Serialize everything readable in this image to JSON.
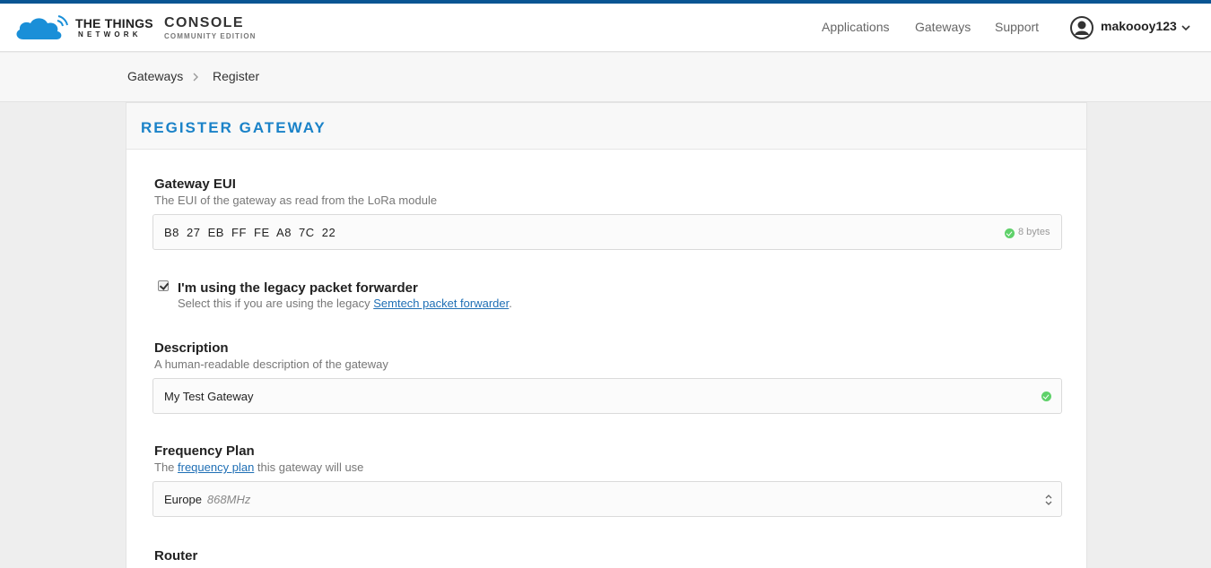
{
  "brand": {
    "name_line1": "THE THINGS",
    "name_line2": "NETWORK",
    "product": "CONSOLE",
    "edition": "COMMUNITY EDITION"
  },
  "nav": {
    "applications": "Applications",
    "gateways": "Gateways",
    "support": "Support",
    "username": "makoooy123"
  },
  "breadcrumb": {
    "items": [
      "Gateways",
      "Register"
    ]
  },
  "page": {
    "title": "REGISTER GATEWAY"
  },
  "form": {
    "eui": {
      "label": "Gateway EUI",
      "help": "The EUI of the gateway as read from the LoRa module",
      "value": "B8 27 EB FF FE A8 7C 22",
      "hint": "8 bytes"
    },
    "legacy": {
      "label": "I'm using the legacy packet forwarder",
      "help_prefix": "Select this if you are using the legacy ",
      "help_link": "Semtech packet forwarder",
      "help_suffix": ".",
      "checked": true
    },
    "description": {
      "label": "Description",
      "help": "A human-readable description of the gateway",
      "value": "My Test Gateway"
    },
    "frequency_plan": {
      "label": "Frequency Plan",
      "help_prefix": "The ",
      "help_link": "frequency plan",
      "help_suffix": " this gateway will use",
      "selected": "Europe",
      "selected_detail": "868MHz"
    },
    "router": {
      "label": "Router"
    }
  },
  "colors": {
    "accent": "#1a82c8",
    "topline": "#0a5593",
    "valid": "#5fd16a",
    "link": "#1f6fb5"
  },
  "icons": {
    "logo": "cloud-wifi-icon",
    "avatar": "user-avatar-icon",
    "dropdown": "chevron-down-icon",
    "breadcrumb_sep": "chevron-right-icon",
    "valid": "check-circle-icon",
    "select": "select-arrows-icon"
  }
}
